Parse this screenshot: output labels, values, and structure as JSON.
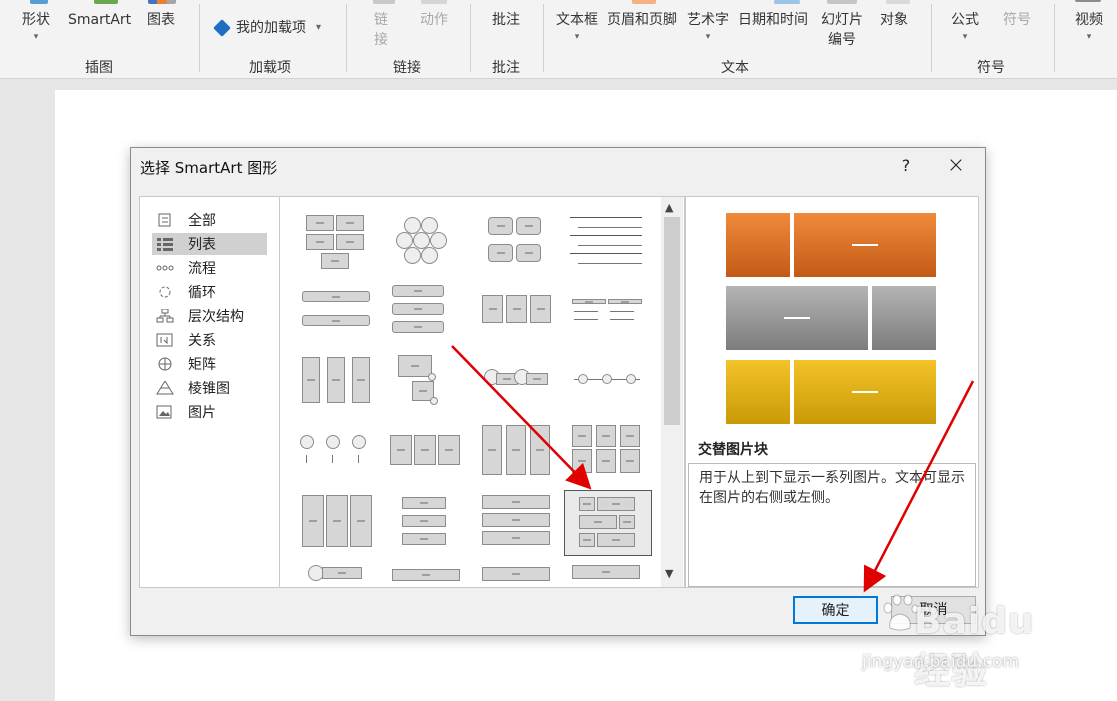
{
  "ribbon": {
    "illustrations": {
      "shape": "形状",
      "smartart": "SmartArt",
      "chart": "图表",
      "label": "插图"
    },
    "addins": {
      "my_addins": "我的加载项",
      "label": "加载项"
    },
    "links": {
      "link": "链接",
      "action": "动作",
      "label": "链接"
    },
    "comments": {
      "comment": "批注",
      "label": "批注"
    },
    "text": {
      "textbox": "文本框",
      "header_footer": "页眉和页脚",
      "wordart": "艺术字",
      "datetime": "日期和时间",
      "slide_number": "幻灯片编号",
      "object": "对象",
      "label": "文本"
    },
    "symbols": {
      "equation": "公式",
      "symbol": "符号",
      "label": "符号"
    },
    "media": {
      "video": "视频"
    }
  },
  "dialog": {
    "title": "选择 SmartArt 图形",
    "help": "?",
    "close": "×",
    "categories": [
      {
        "label": "全部",
        "selected": false
      },
      {
        "label": "列表",
        "selected": true
      },
      {
        "label": "流程",
        "selected": false
      },
      {
        "label": "循环",
        "selected": false
      },
      {
        "label": "层次结构",
        "selected": false
      },
      {
        "label": "关系",
        "selected": false
      },
      {
        "label": "矩阵",
        "selected": false
      },
      {
        "label": "棱锥图",
        "selected": false
      },
      {
        "label": "图片",
        "selected": false
      }
    ],
    "preview": {
      "name": "交替图片块",
      "description": "用于从上到下显示一系列图片。文本可显示在图片的右侧或左侧。",
      "colors": {
        "orange": "#e2731f",
        "gray": "#9a9a9a",
        "gold": "#e2b012"
      }
    },
    "ok_label": "确定",
    "cancel_label": "取消"
  },
  "annotation": {
    "arrow_color": "#e00000"
  },
  "watermark": {
    "brand": "Baidu经验",
    "url": "jingyan.baidu.com"
  }
}
